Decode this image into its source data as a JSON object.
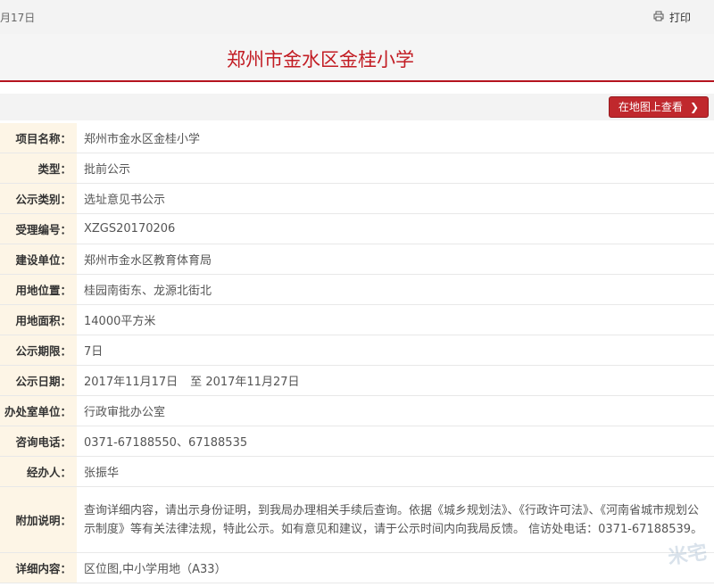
{
  "header": {
    "date": "月17日",
    "print_label": "打印",
    "title": "郑州市金水区金桂小学"
  },
  "map_button_label": "在地图上查看",
  "fields": [
    {
      "label": "项目名称：",
      "value": "郑州市金水区金桂小学"
    },
    {
      "label": "类型：",
      "value": "批前公示"
    },
    {
      "label": "公示类别：",
      "value": "选址意见书公示"
    },
    {
      "label": "受理编号：",
      "value": "XZGS20170206"
    },
    {
      "label": "建设单位：",
      "value": "郑州市金水区教育体育局"
    },
    {
      "label": "用地位置：",
      "value": "桂园南街东、龙源北街北"
    },
    {
      "label": "用地面积：",
      "value": "14000平方米"
    },
    {
      "label": "公示期限：",
      "value": "7日"
    },
    {
      "label": "公示日期：",
      "start": "2017年11月17日",
      "to": "至",
      "end": "2017年11月27日"
    },
    {
      "label": "办处室单位：",
      "value": "行政审批办公室"
    },
    {
      "label": "咨询电话：",
      "value": "0371-67188550、67188535"
    },
    {
      "label": "经办人：",
      "value": "张振华"
    },
    {
      "label": "附加说明：",
      "value": "查询详细内容，请出示身份证明，到我局办理相关手续后查询。依据《城乡规划法》、《行政许可法》、《河南省城市规划公示制度》等有关法律法规，特此公示。如有意见和建议，请于公示时间内向我局反馈。 信访处电话：0371-67188539。"
    },
    {
      "label": "详细内容：",
      "value": "区位图,中小学用地（A33）"
    }
  ],
  "watermark": "米宅",
  "icons": {
    "print": "printer-icon",
    "map_chevron": "chevron-right-icon"
  }
}
